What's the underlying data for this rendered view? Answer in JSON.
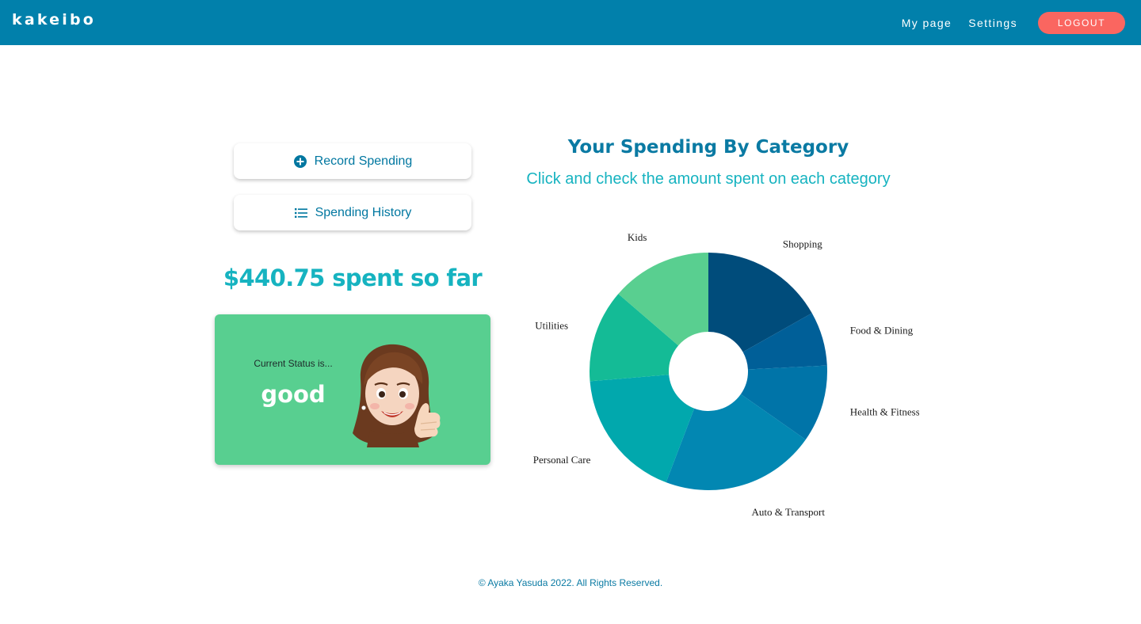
{
  "navbar": {
    "brand": "kakeibo",
    "links": [
      "My page",
      "Settings"
    ],
    "logout_label": "LOGOUT"
  },
  "actions": {
    "record_label": "Record Spending",
    "history_label": "Spending History"
  },
  "summary": {
    "spent_text": "$440.75 spent so far"
  },
  "status": {
    "label": "Current Status is...",
    "value": "good"
  },
  "chart": {
    "title": "Your Spending By Category",
    "subtitle": "Click and check the amount spent on each category"
  },
  "chart_data": {
    "type": "pie",
    "donut": true,
    "categories": [
      "Shopping",
      "Food & Dining",
      "Health & Fitness",
      "Auto & Transport",
      "Personal Care",
      "Utilities",
      "Kids"
    ],
    "values": [
      16,
      7,
      10,
      20,
      17,
      12,
      13
    ],
    "colors": [
      "#004c7b",
      "#005f98",
      "#0074a8",
      "#0287b2",
      "#01a8ad",
      "#14bb96",
      "#59cf90"
    ],
    "legend": "labels on slices"
  },
  "footer": {
    "text": "© Ayaka Yasuda 2022. All Rights Reserved."
  }
}
